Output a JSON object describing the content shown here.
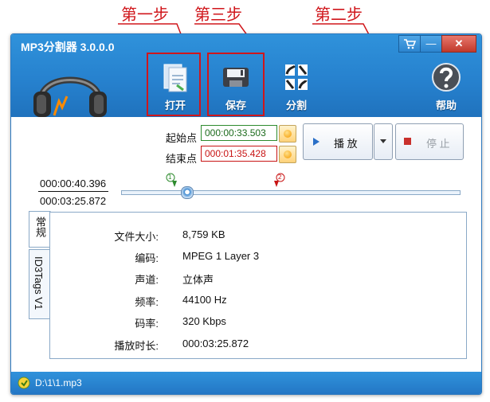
{
  "annotations": {
    "step1": "第一步",
    "step2": "第二步",
    "step3": "第三步"
  },
  "window": {
    "title": "MP3分割器 3.0.0.0",
    "controls": {
      "cart_icon": "cart-icon",
      "minimize": "—",
      "close": "✕"
    }
  },
  "toolbar": {
    "open_label": "打开",
    "save_label": "保存",
    "split_label": "分割",
    "help_label": "帮助"
  },
  "range": {
    "start_label": "起始点",
    "start_value": "000:00:33.503",
    "end_label": "结束点",
    "end_value": "000:01:35.428",
    "play_label": "播 放",
    "stop_label": "停 止",
    "marker1": "1",
    "marker2": "2"
  },
  "position": {
    "current_time": "000:00:40.396",
    "total_time": "000:03:25.872"
  },
  "tabs": {
    "general": "常规",
    "id3tags": "ID3Tags V1"
  },
  "info": [
    {
      "key": "文件大小:",
      "value": "8,759 KB"
    },
    {
      "key": "编码:",
      "value": "MPEG 1 Layer 3"
    },
    {
      "key": "声道:",
      "value": "立体声"
    },
    {
      "key": "频率:",
      "value": "44100 Hz"
    },
    {
      "key": "码率:",
      "value": "320 Kbps"
    },
    {
      "key": "播放时长:",
      "value": "000:03:25.872"
    }
  ],
  "status": {
    "path": "D:\\1\\1.mp3"
  },
  "colors": {
    "accent_red": "#d0161b",
    "titlebar_blue": "#2680cd",
    "start_green": "#2e8b2e",
    "end_red": "#c81414"
  }
}
